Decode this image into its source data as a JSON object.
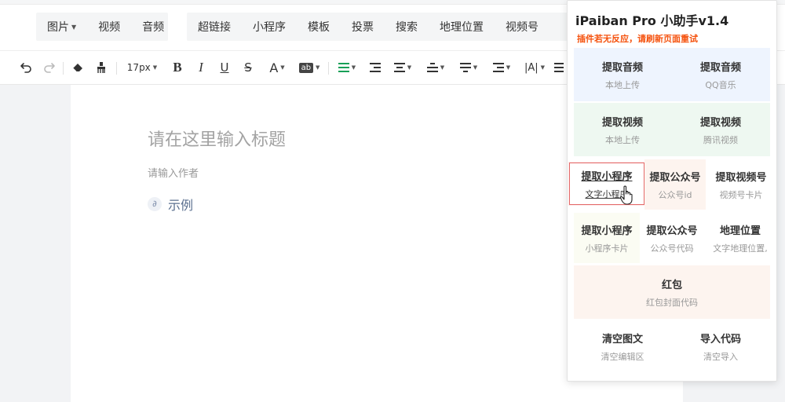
{
  "insert_bar": {
    "group1": [
      {
        "label": "图片",
        "has_dropdown": true
      },
      {
        "label": "视频",
        "has_dropdown": false
      },
      {
        "label": "音频",
        "has_dropdown": false
      }
    ],
    "group2": [
      "超链接",
      "小程序",
      "模板",
      "投票",
      "搜索",
      "地理位置",
      "视频号"
    ]
  },
  "format_bar": {
    "font_size": "17px",
    "bold_label": "B",
    "italic_label": "I",
    "underline_label": "U",
    "strike_label": "S",
    "font_color_label": "A",
    "bg_color_label": "ab",
    "letter_spacing_label": "|A|"
  },
  "editor": {
    "title_placeholder": "请在这里输入标题",
    "author_placeholder": "请输入作者",
    "example_link": "示例"
  },
  "plugin": {
    "title": "iPaiban Pro 小助手v1.4",
    "warning": "插件若无反应，请刷新页面重试",
    "tiles": [
      {
        "label": "提取音频",
        "sub": "本地上传"
      },
      {
        "label": "提取音频",
        "sub": "QQ音乐"
      },
      {
        "label": "提取视频",
        "sub": "本地上传"
      },
      {
        "label": "提取视频",
        "sub": "腾讯视频"
      },
      {
        "label": "提取小程序",
        "sub": "文字小程序"
      },
      {
        "label": "提取公众号",
        "sub": "公众号id"
      },
      {
        "label": "提取视频号",
        "sub": "视频号卡片"
      },
      {
        "label": "提取小程序",
        "sub": "小程序卡片"
      },
      {
        "label": "提取公众号",
        "sub": "公众号代码"
      },
      {
        "label": "地理位置",
        "sub": "文字地理位置,"
      },
      {
        "label": "红包",
        "sub": "红包封面代码"
      },
      {
        "label": "清空图文",
        "sub": "清空编辑区"
      },
      {
        "label": "导入代码",
        "sub": "清空导入"
      }
    ]
  },
  "colors": {
    "warning": "#f5520e",
    "active_border": "#e46a6a",
    "align_active": "#18a058"
  }
}
